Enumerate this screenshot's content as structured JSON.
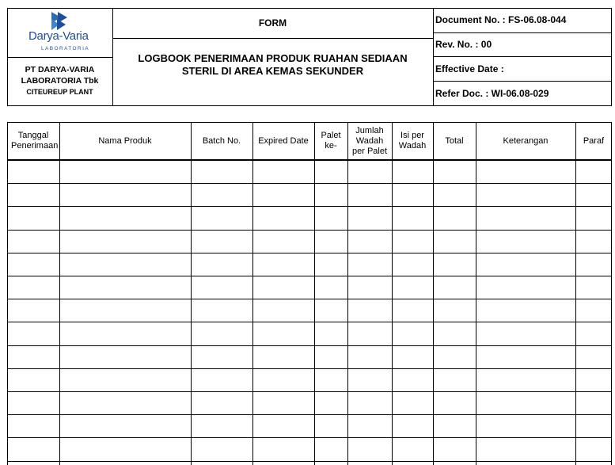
{
  "header": {
    "logo": {
      "brand": "Darya-Varia",
      "sub": "LABORATORIA"
    },
    "company": {
      "line1": "PT DARYA-VARIA",
      "line2": "LABORATORIA Tbk",
      "line3": "CITEUREUP PLANT"
    },
    "form_label": "FORM",
    "title_line1": "LOGBOOK PENERIMAAN PRODUK RUAHAN SEDIAAN",
    "title_line2": "STERIL DI AREA KEMAS SEKUNDER",
    "document_no": "Document No. : FS-06.08-044",
    "rev_no": "Rev. No. : 00",
    "effective_date": "Effective Date :",
    "refer_doc": "Refer Doc. : WI-06.08-029"
  },
  "table": {
    "columns": [
      "Tanggal Penerimaan",
      "Nama Produk",
      "Batch No.",
      "Expired Date",
      "Palet ke-",
      "Jumlah Wadah per Palet",
      "Isi per Wadah",
      "Total",
      "Keterangan",
      "Paraf"
    ],
    "empty_rows": 13
  },
  "colors": {
    "border": "#000000",
    "logo_blue": "#1f4f9a",
    "logo_accent": "#2a6db3"
  }
}
